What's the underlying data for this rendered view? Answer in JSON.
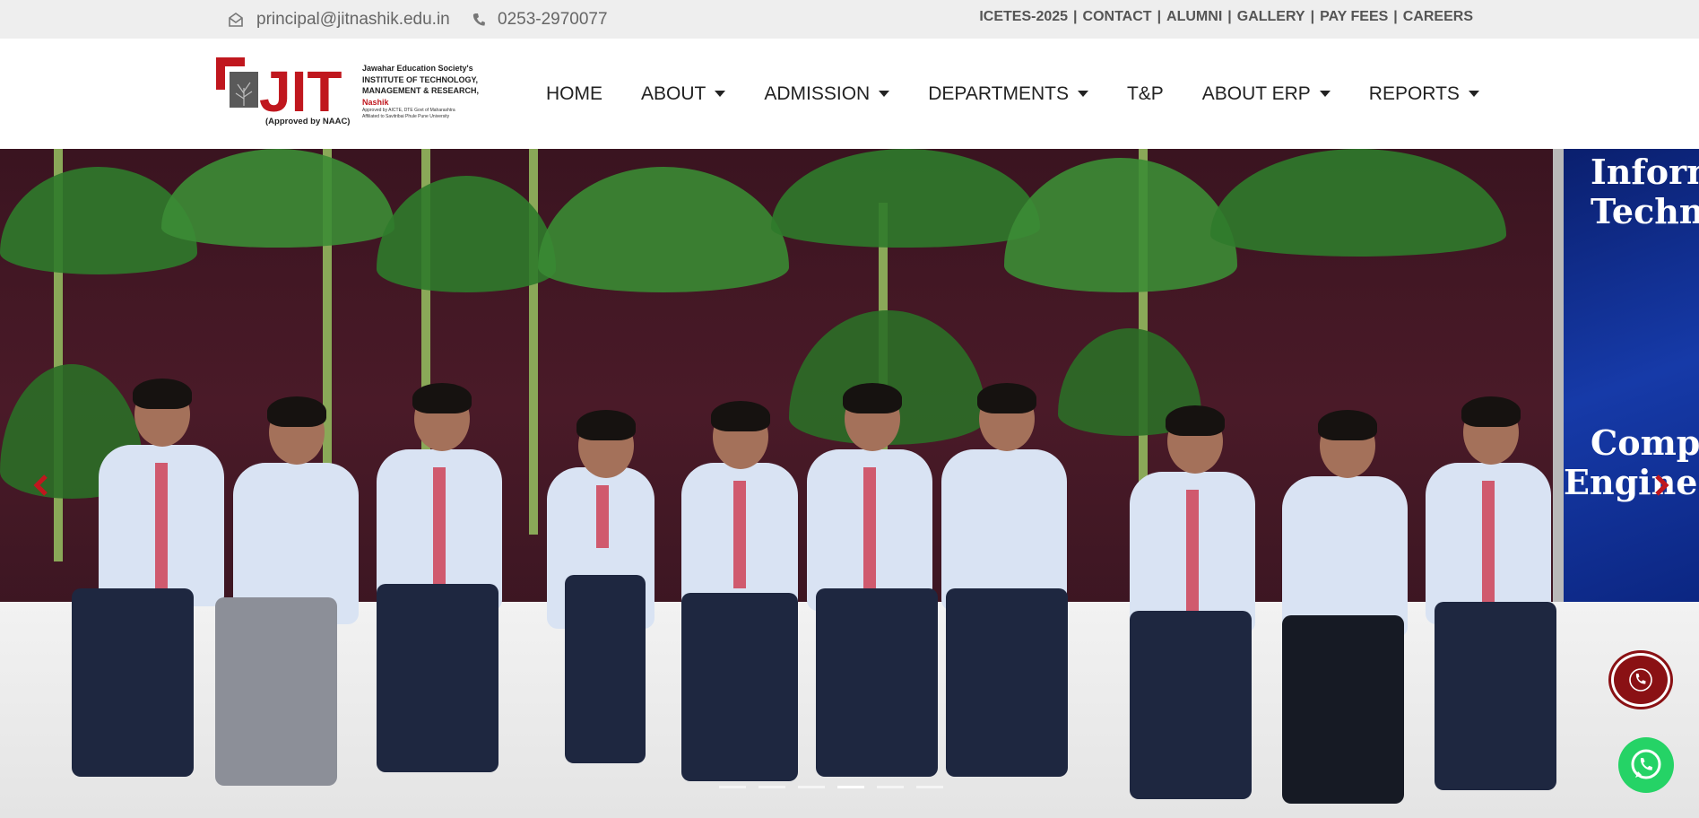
{
  "topbar": {
    "email": "principal@jitnashik.edu.in",
    "phone": "0253-2970077",
    "links": [
      "ICETES-2025",
      "CONTACT",
      "ALUMNI",
      "GALLERY",
      "PAY FEES",
      "CAREERS"
    ]
  },
  "logo": {
    "letters": "JIT",
    "line1": "Jawahar Education Society's",
    "line2": "INSTITUTE OF TECHNOLOGY,",
    "line3": "MANAGEMENT & RESEARCH,",
    "city": "Nashik",
    "approval": "Approved by AICTE, DTE Govt of Maharashtra",
    "affiliation": "Affiliated to Savitribai Phule Pune University",
    "naac": "(Approved by NAAC)"
  },
  "nav": {
    "items": [
      {
        "label": "HOME",
        "dropdown": false
      },
      {
        "label": "ABOUT",
        "dropdown": true
      },
      {
        "label": "ADMISSION",
        "dropdown": true
      },
      {
        "label": "DEPARTMENTS",
        "dropdown": true
      },
      {
        "label": "T&P",
        "dropdown": false
      },
      {
        "label": "ABOUT ERP",
        "dropdown": true
      },
      {
        "label": "REPORTS",
        "dropdown": true
      }
    ]
  },
  "hero": {
    "banner_line1": "Inform",
    "banner_line2": "Techno",
    "banner_line3": "Comp",
    "banner_line4": "Engine",
    "slides": 6,
    "active_slide": 3
  },
  "colors": {
    "brand_red": "#c0171e",
    "call_button": "#8a1114",
    "whatsapp": "#25d366",
    "topbar_bg": "#eeeeee"
  },
  "icons": [
    "envelope-icon",
    "phone-icon",
    "caret-down-icon",
    "chevron-left-icon",
    "chevron-right-icon",
    "phone-call-icon",
    "whatsapp-icon"
  ]
}
